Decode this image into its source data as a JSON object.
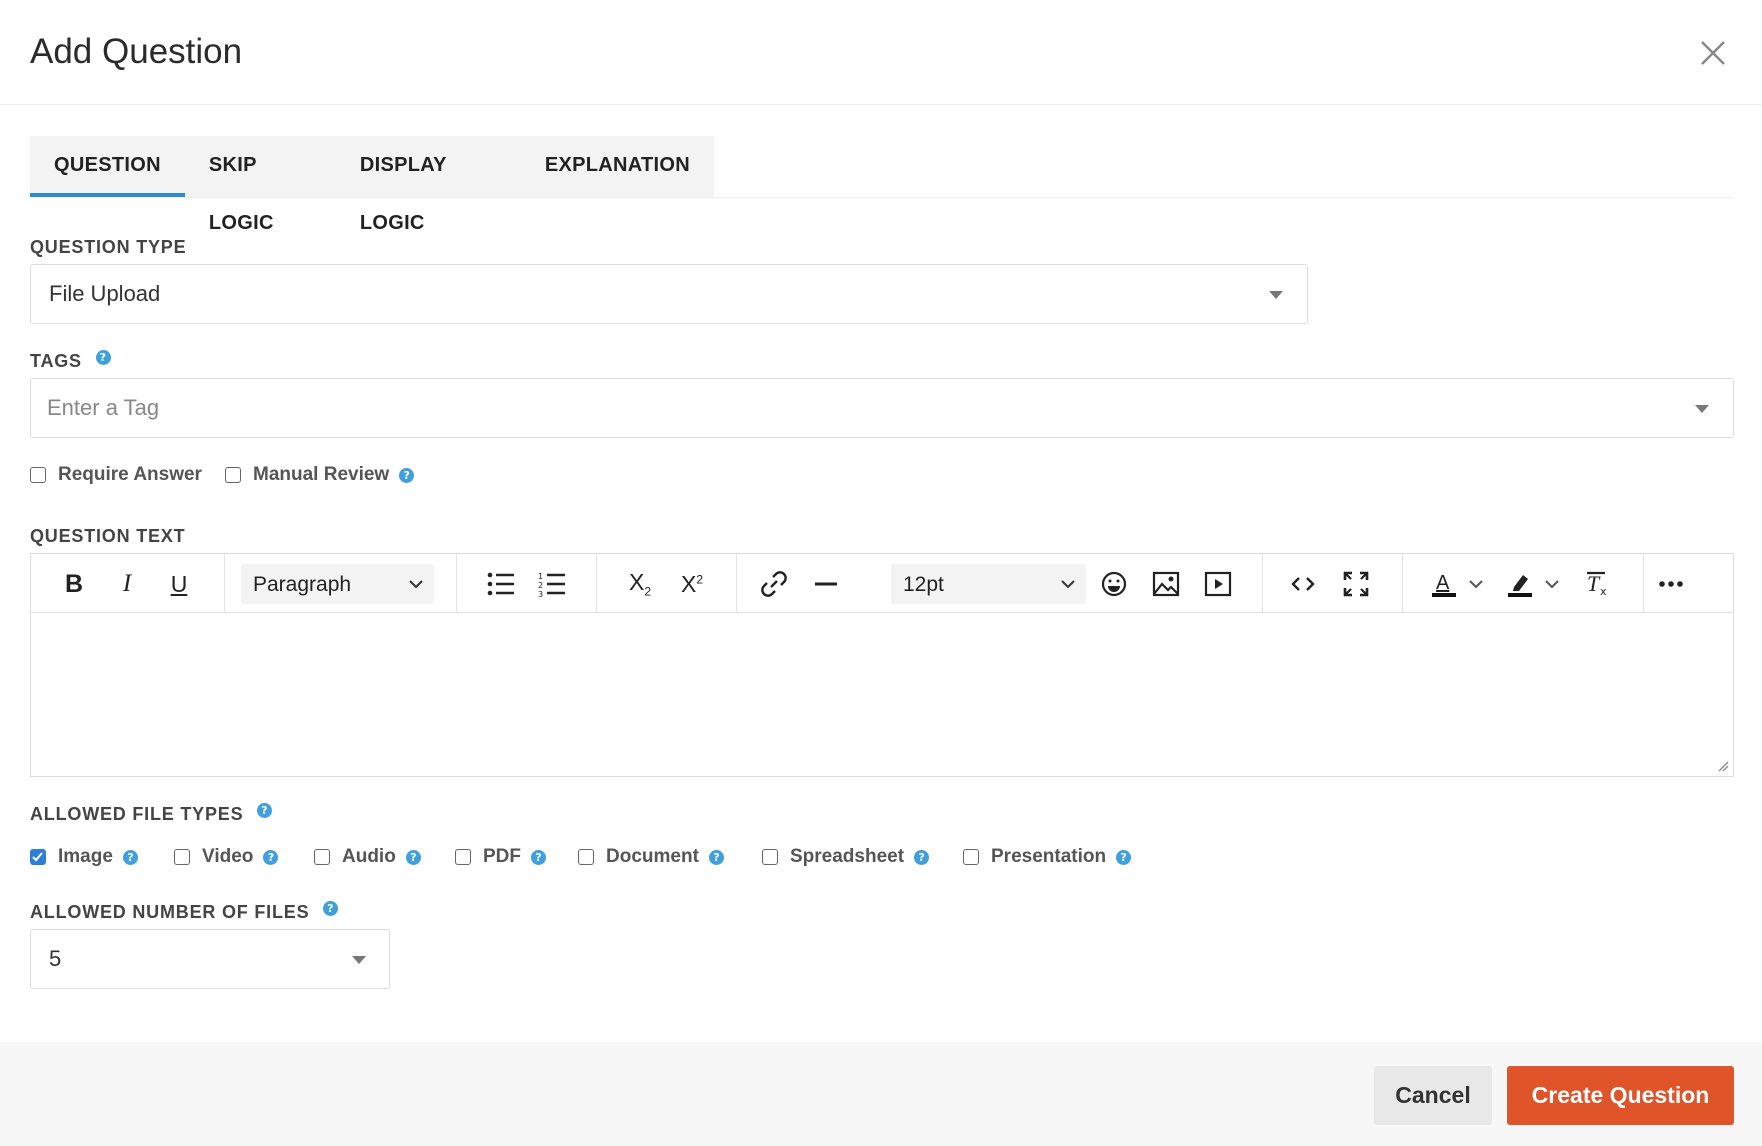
{
  "dialog": {
    "title": "Add Question"
  },
  "tabs": [
    {
      "label": "QUESTION",
      "active": true
    },
    {
      "label": "SKIP LOGIC",
      "active": false
    },
    {
      "label": "DISPLAY LOGIC",
      "active": false
    },
    {
      "label": "EXPLANATION",
      "active": false
    }
  ],
  "question_type": {
    "label": "QUESTION TYPE",
    "value": "File Upload"
  },
  "tags": {
    "label": "TAGS",
    "placeholder": "Enter a Tag"
  },
  "options": [
    {
      "label": "Require Answer",
      "checked": false
    },
    {
      "label": "Manual Review",
      "checked": false
    }
  ],
  "question_text": {
    "label": "QUESTION TEXT",
    "block_format": "Paragraph",
    "font_size": "12pt"
  },
  "file_types": {
    "label": "ALLOWED FILE TYPES",
    "items": [
      {
        "label": "Image",
        "checked": true
      },
      {
        "label": "Video",
        "checked": false
      },
      {
        "label": "Audio",
        "checked": false
      },
      {
        "label": "PDF",
        "checked": false
      },
      {
        "label": "Document",
        "checked": false
      },
      {
        "label": "Spreadsheet",
        "checked": false
      },
      {
        "label": "Presentation",
        "checked": false
      }
    ]
  },
  "num_files": {
    "label": "ALLOWED NUMBER OF FILES",
    "value": "5"
  },
  "footer": {
    "cancel_label": "Cancel",
    "create_label": "Create Question"
  },
  "colors": {
    "accent": "#2f8ad1",
    "primary_button": "#e0542a",
    "help_icon": "#3fa0dd",
    "checkbox_checked": "#2f7fd6"
  }
}
